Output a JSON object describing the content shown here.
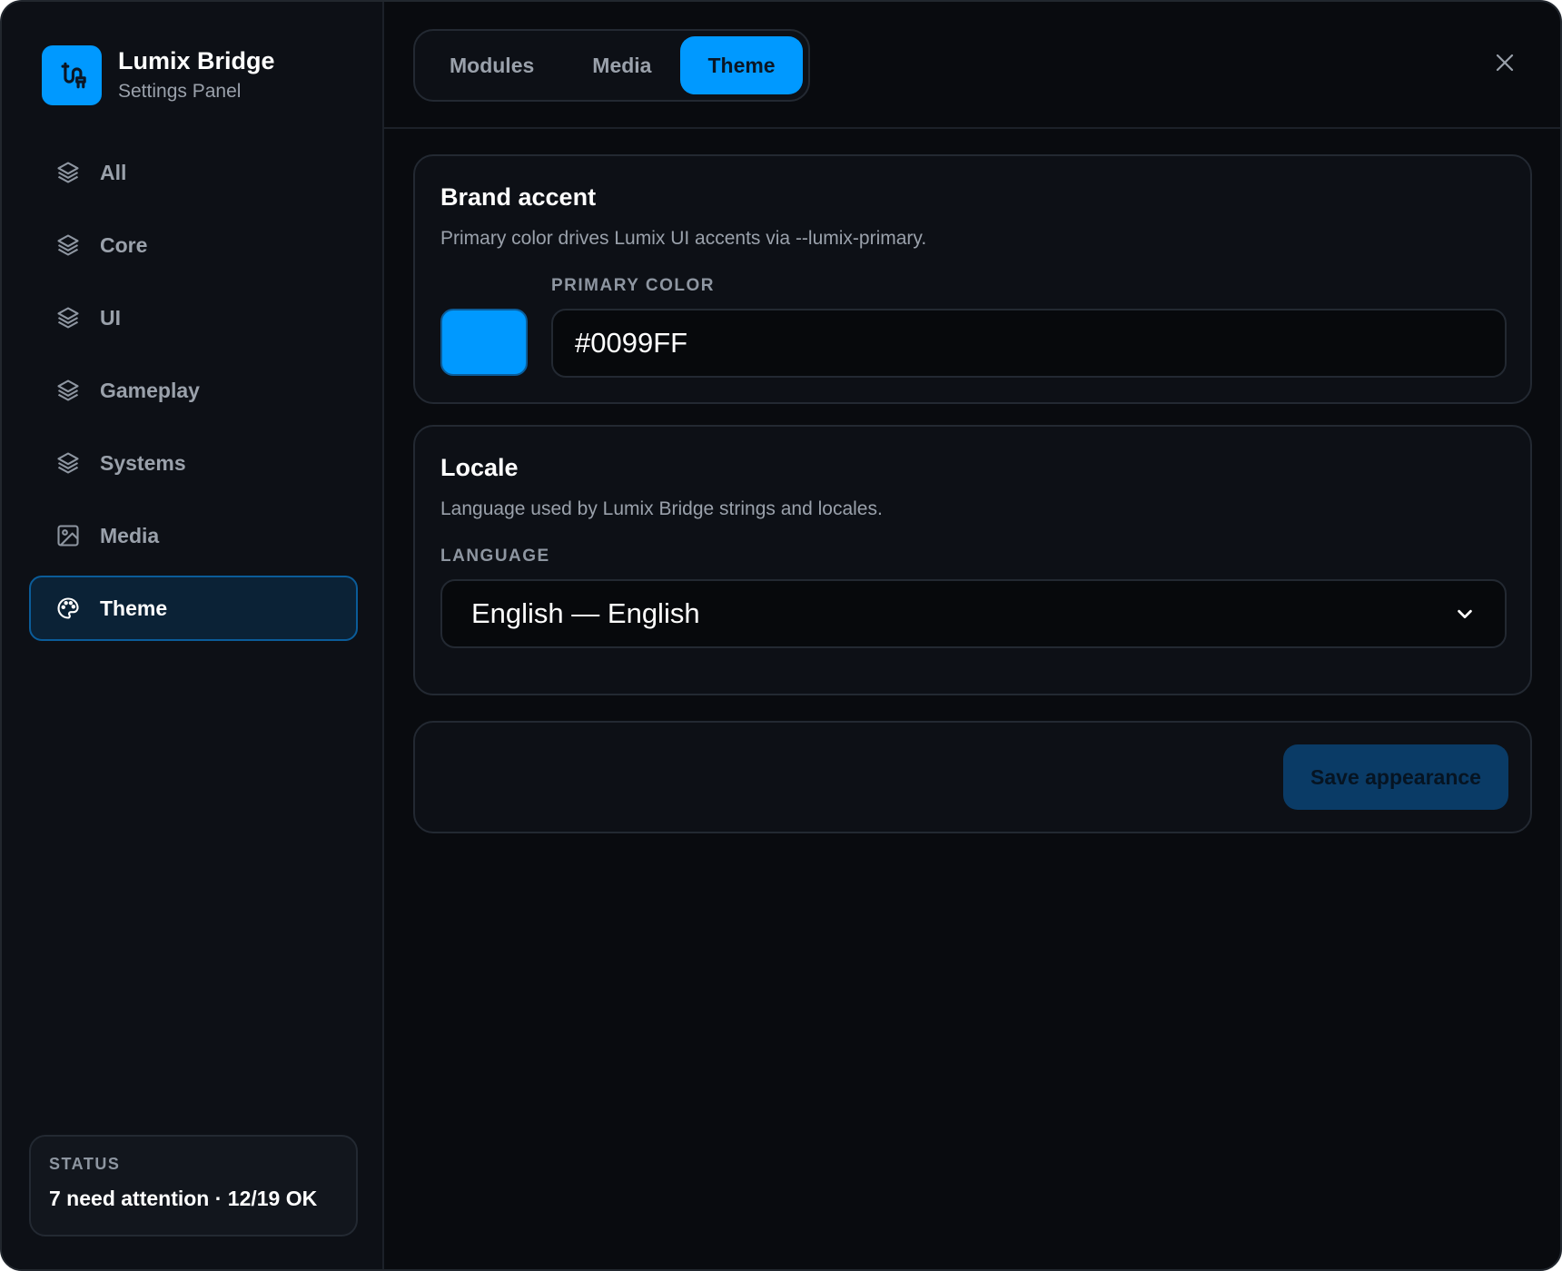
{
  "brand": {
    "title": "Lumix Bridge",
    "subtitle": "Settings Panel",
    "icon": "plug-icon"
  },
  "sidebar": {
    "items": [
      {
        "label": "All",
        "icon": "layers-icon",
        "active": false
      },
      {
        "label": "Core",
        "icon": "layers-icon",
        "active": false
      },
      {
        "label": "UI",
        "icon": "layers-icon",
        "active": false
      },
      {
        "label": "Gameplay",
        "icon": "layers-icon",
        "active": false
      },
      {
        "label": "Systems",
        "icon": "layers-icon",
        "active": false
      },
      {
        "label": "Media",
        "icon": "image-icon",
        "active": false
      },
      {
        "label": "Theme",
        "icon": "palette-icon",
        "active": true
      }
    ]
  },
  "status": {
    "title": "STATUS",
    "text": "7 need attention · 12/19 OK"
  },
  "tabs": [
    {
      "label": "Modules",
      "active": false
    },
    {
      "label": "Media",
      "active": false
    },
    {
      "label": "Theme",
      "active": true
    }
  ],
  "brand_accent": {
    "title": "Brand accent",
    "description": "Primary color drives Lumix UI accents via --lumix-primary.",
    "field_label": "PRIMARY COLOR",
    "value": "#0099FF",
    "swatch_color": "#0099ff"
  },
  "locale": {
    "title": "Locale",
    "description": "Language used by Lumix Bridge strings and locales.",
    "field_label": "LANGUAGE",
    "selected": "English — English"
  },
  "actions": {
    "save_label": "Save appearance"
  },
  "colors": {
    "accent": "#0099ff",
    "background": "#090b0f",
    "panel": "#0d1016"
  }
}
